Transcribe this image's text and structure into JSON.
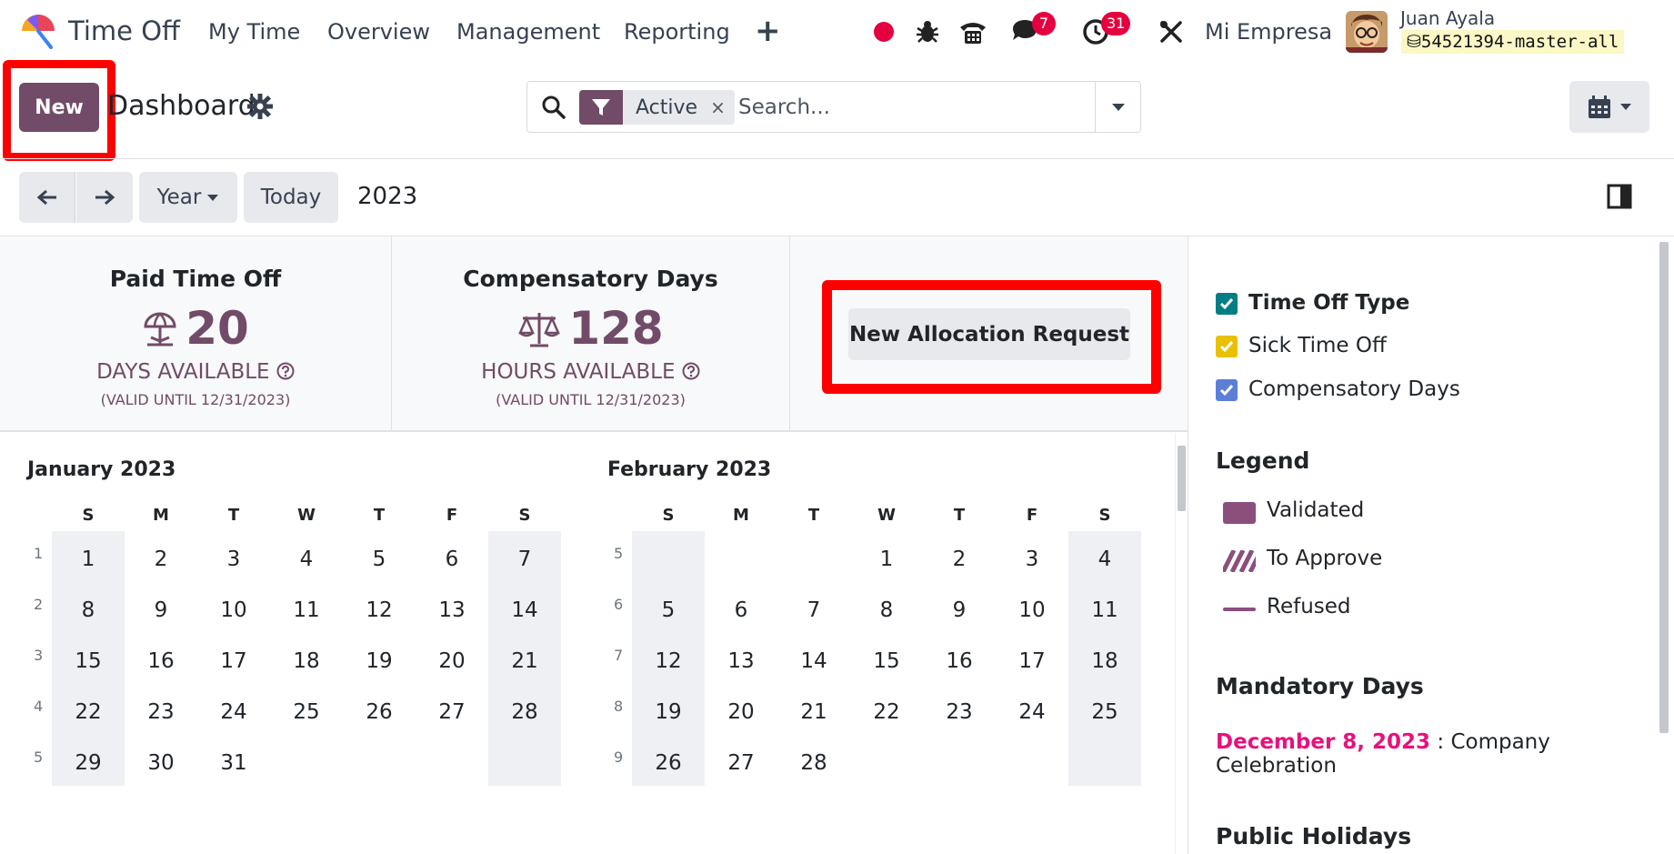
{
  "navbar": {
    "app_name": "Time Off",
    "menus": [
      "My Time",
      "Overview",
      "Management",
      "Reporting"
    ],
    "plus": "+",
    "messages_badge": "7",
    "activities_badge": "31",
    "company": "Mi Empresa",
    "user_name": "Juan Ayala",
    "db_name": "54521394-master-all"
  },
  "control": {
    "new_label": "New",
    "title": "Dashboard",
    "facet_label": "Active",
    "facet_remove": "×",
    "search_placeholder": "Search...",
    "range_label": "Year",
    "today_label": "Today",
    "year": "2023"
  },
  "summary": [
    {
      "title": "Paid Time Off",
      "value": "20",
      "unit": "DAYS AVAILABLE",
      "valid": "(VALID UNTIL 12/31/2023)",
      "icon": "beach-umbrella-icon"
    },
    {
      "title": "Compensatory Days",
      "value": "128",
      "unit": "HOURS AVAILABLE",
      "valid": "(VALID UNTIL 12/31/2023)",
      "icon": "balance-scale-icon"
    }
  ],
  "allocation_button": "New Allocation Request",
  "calendar": {
    "weekdays": [
      "S",
      "M",
      "T",
      "W",
      "T",
      "F",
      "S"
    ],
    "months": [
      {
        "title": "January 2023",
        "weeks": [
          {
            "num": "1",
            "days": [
              "1",
              "2",
              "3",
              "4",
              "5",
              "6",
              "7"
            ]
          },
          {
            "num": "2",
            "days": [
              "8",
              "9",
              "10",
              "11",
              "12",
              "13",
              "14"
            ]
          },
          {
            "num": "3",
            "days": [
              "15",
              "16",
              "17",
              "18",
              "19",
              "20",
              "21"
            ]
          },
          {
            "num": "4",
            "days": [
              "22",
              "23",
              "24",
              "25",
              "26",
              "27",
              "28"
            ]
          },
          {
            "num": "5",
            "days": [
              "29",
              "30",
              "31",
              "",
              "",
              "",
              ""
            ]
          }
        ]
      },
      {
        "title": "February 2023",
        "weeks": [
          {
            "num": "5",
            "days": [
              "",
              "",
              "",
              "1",
              "2",
              "3",
              "4"
            ]
          },
          {
            "num": "6",
            "days": [
              "5",
              "6",
              "7",
              "8",
              "9",
              "10",
              "11"
            ]
          },
          {
            "num": "7",
            "days": [
              "12",
              "13",
              "14",
              "15",
              "16",
              "17",
              "18"
            ]
          },
          {
            "num": "8",
            "days": [
              "19",
              "20",
              "21",
              "22",
              "23",
              "24",
              "25"
            ]
          },
          {
            "num": "9",
            "days": [
              "26",
              "27",
              "28",
              "",
              "",
              "",
              ""
            ]
          }
        ]
      }
    ]
  },
  "side": {
    "filters": [
      {
        "label": "Time Off Type",
        "color": "#017e84",
        "bold": true
      },
      {
        "label": "Sick Time Off",
        "color": "#e9c002",
        "bold": false
      },
      {
        "label": "Compensatory Days",
        "color": "#5b7fd6",
        "bold": false
      }
    ],
    "legend_title": "Legend",
    "legend": [
      "Validated",
      "To Approve",
      "Refused"
    ],
    "mandatory_title": "Mandatory Days",
    "mandatory_date": "December 8, 2023",
    "mandatory_sep": " : ",
    "mandatory_name": "Company Celebration",
    "holidays_title": "Public Holidays"
  },
  "colors": {
    "brand": "#714b67",
    "highlight": "#ff0000",
    "mandatory": "#e6127d"
  }
}
